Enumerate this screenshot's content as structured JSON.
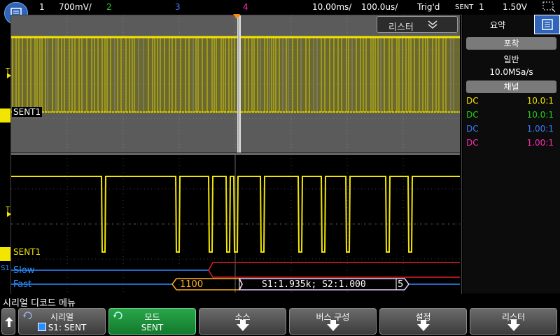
{
  "topbar": {
    "ch1_num": "1",
    "ch1_scale": "700mV/",
    "ch2_num": "2",
    "ch3_num": "3",
    "ch4_num": "4",
    "timebase": "10.00ms/",
    "zoom_timebase": "100.0us/",
    "trigger_status": "Trig'd",
    "trigger_type": "SENT",
    "trigger_source": "1",
    "trigger_level": "1.50V"
  },
  "scope": {
    "lister_label": "리스터",
    "sent1_label_top": "SENT1",
    "sent1_label_bottom": "SENT1",
    "serial_tag": "S1",
    "slow_label": "Slow",
    "fast_label": "Fast",
    "fast_value": "1100",
    "fast_decode": "S1:1.935k; S2:1.000",
    "fast_crc": "5",
    "trigger_marker": "T"
  },
  "sidepanel": {
    "tab_summary": "요약",
    "acq_header": "포착",
    "acq_mode": "일반",
    "acq_rate": "10.0MSa/s",
    "channel_header": "채널",
    "channels": [
      {
        "coupling": "DC",
        "probe": "10.0:1",
        "color": "#f2e500"
      },
      {
        "coupling": "DC",
        "probe": "10.0:1",
        "color": "#22d022"
      },
      {
        "coupling": "DC",
        "probe": "1.00:1",
        "color": "#3d7bff"
      },
      {
        "coupling": "DC",
        "probe": "1.00:1",
        "color": "#ff2bb0"
      }
    ]
  },
  "menu": {
    "title": "시리얼 디코드 메뉴",
    "sk1_top": "시리얼",
    "sk1_bottom": "S1: SENT",
    "sk2_top": "모드",
    "sk2_bottom": "SENT",
    "sk3_top": "소스",
    "sk4_top": "버스 구성",
    "sk5_top": "설정",
    "sk6_top": "리스터"
  },
  "colors": {
    "ch1": "#f2e500",
    "ch2": "#22d022",
    "ch3": "#3d7bff",
    "ch4": "#ff2bb0",
    "slow_bus": "#2a8cff",
    "fast_bus": "#e02020",
    "softkey_active": "#1f9a40"
  },
  "icons": [
    "menu-icon",
    "lister-chevron-icon",
    "back-arrow-icon",
    "ground-icon",
    "down-arrow-icon",
    "sidebar-menu-icon"
  ]
}
